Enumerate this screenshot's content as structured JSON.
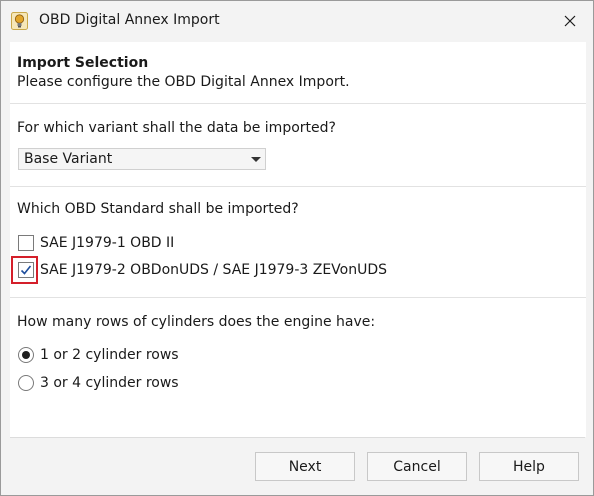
{
  "window": {
    "title": "OBD Digital Annex Import",
    "icon": "lightbulb-app-icon",
    "close_icon": "close-icon"
  },
  "header": {
    "title": "Import Selection",
    "subtitle": "Please configure the OBD Digital Annex Import."
  },
  "variant": {
    "question": "For which variant shall the data be imported?",
    "selected": "Base Variant"
  },
  "standard": {
    "question": "Which OBD Standard shall be imported?",
    "options": [
      {
        "label": "SAE J1979-1 OBD II",
        "checked": false
      },
      {
        "label": "SAE J1979-2 OBDonUDS / SAE J1979-3 ZEVonUDS",
        "checked": true
      }
    ]
  },
  "cylinders": {
    "question": "How many rows of cylinders does the engine have:",
    "options": [
      {
        "label": "1 or 2 cylinder rows",
        "selected": true
      },
      {
        "label": "3 or 4 cylinder rows",
        "selected": false
      }
    ]
  },
  "footer": {
    "next_label": "Next",
    "cancel_label": "Cancel",
    "help_label": "Help"
  },
  "colors": {
    "highlight": "#d41f2a",
    "checkmark": "#1f4e9c"
  }
}
